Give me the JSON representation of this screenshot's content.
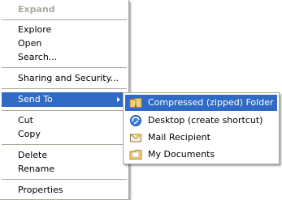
{
  "context_menu": {
    "expand": "Expand",
    "explore": "Explore",
    "open": "Open",
    "search": "Search...",
    "sharing_security": "Sharing and Security...",
    "send_to": "Send To",
    "cut": "Cut",
    "copy": "Copy",
    "delete": "Delete",
    "rename": "Rename",
    "properties": "Properties"
  },
  "send_to_menu": {
    "items": [
      {
        "label": "Compressed (zipped) Folder",
        "icon": "zip-folder-icon"
      },
      {
        "label": "Desktop (create shortcut)",
        "icon": "desktop-icon"
      },
      {
        "label": "Mail Recipient",
        "icon": "mail-icon"
      },
      {
        "label": "My Documents",
        "icon": "folder-icon"
      }
    ]
  },
  "colors": {
    "highlight": "#316ac5",
    "border": "#aca899",
    "disabled_text": "#aca899"
  }
}
